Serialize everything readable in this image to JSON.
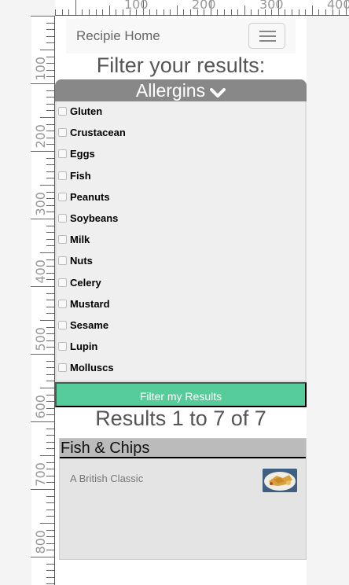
{
  "ruler": {
    "top_labels": [
      "100",
      "200",
      "300",
      "400"
    ],
    "left_labels": [
      "100",
      "200",
      "300",
      "400",
      "500",
      "600",
      "700",
      "800"
    ]
  },
  "navbar": {
    "brand": "Recipie Home",
    "toggle_icon": "hamburger-icon"
  },
  "filter": {
    "heading": "Filter your results:",
    "allergens_label": "Allergins",
    "allergens_icon": "chevron-down-icon",
    "allergens": [
      "Gluten",
      "Crustacean",
      "Eggs",
      "Fish",
      "Peanuts",
      "Soybeans",
      "Milk",
      "Nuts",
      "Celery",
      "Mustard",
      "Sesame",
      "Lupin",
      "Molluscs"
    ],
    "submit_label": "Filter my Results"
  },
  "results": {
    "heading": "Results 1 to 7 of 7",
    "items": [
      {
        "title": "Fish & Chips",
        "description": "A British Classic"
      }
    ]
  },
  "colors": {
    "accent": "#55cc9a",
    "header_grey": "#888888"
  }
}
